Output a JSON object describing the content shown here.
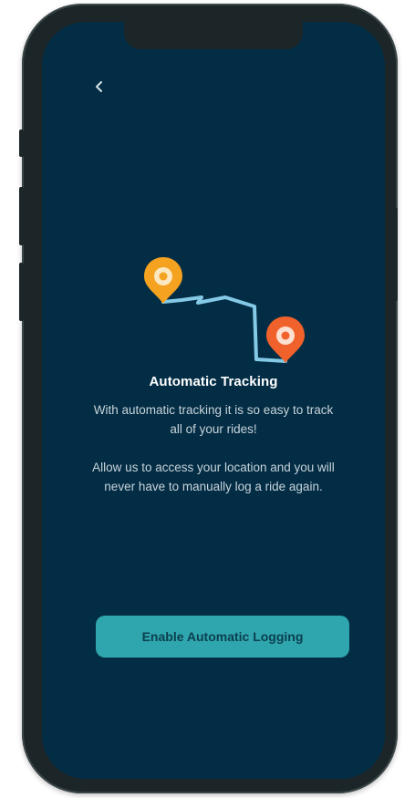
{
  "onboarding": {
    "title": "Automatic Tracking",
    "description_1": "With automatic tracking it is so easy to track all of your rides!",
    "description_2": "Allow us to access your location and you will never have to manually log a ride again.",
    "cta_label": "Enable Automatic Logging"
  },
  "icons": {
    "back": "chevron-left-icon",
    "start_pin": "map-pin-icon",
    "end_pin": "map-pin-icon"
  },
  "colors": {
    "background": "#032d45",
    "start_pin": "#f4a21f",
    "end_pin": "#f0612b",
    "route": "#84c9e6",
    "button": "#2fa6ad",
    "button_text": "#0b3f4f",
    "title": "#ffffff",
    "body_text": "#c8d3da"
  }
}
